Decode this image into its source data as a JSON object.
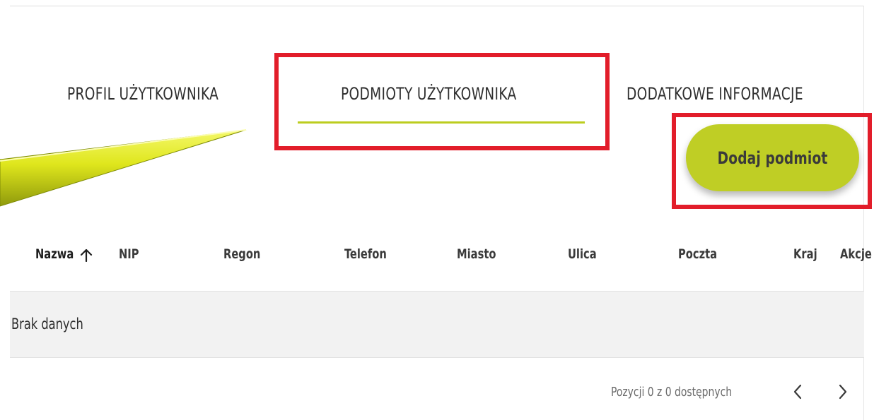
{
  "tabs": {
    "profil": "PROFIL UŻYTKOWNIKA",
    "podmioty": "PODMIOTY UŻYTKOWNIKA",
    "dodatkowe": "DODATKOWE INFORMACJE",
    "active": "podmioty"
  },
  "actions": {
    "add_entity_label": "Dodaj podmiot"
  },
  "table": {
    "columns": [
      "Nazwa",
      "NIP",
      "Regon",
      "Telefon",
      "Miasto",
      "Ulica",
      "Poczta",
      "Kraj",
      "Akcje"
    ],
    "sort": {
      "column": "Nazwa",
      "direction": "ascending",
      "icon": "arrow-up-icon"
    },
    "empty_message": "Brak danych"
  },
  "pagination": {
    "info": "Pozycji 0 z 0 dostępnych",
    "prev_icon": "chevron-left-icon",
    "next_icon": "chevron-right-icon"
  },
  "colors": {
    "accent": "#bfce25",
    "highlight_box": "#e21d2a",
    "pointer_arrow": "#e3ea1e",
    "empty_row_bg": "#f2f2f2"
  }
}
